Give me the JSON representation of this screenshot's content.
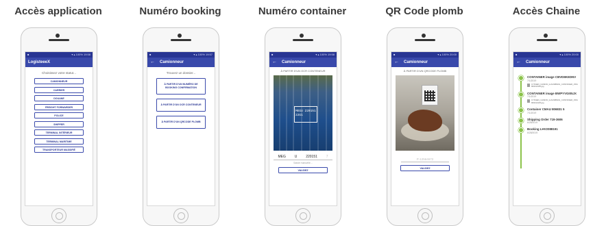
{
  "columns": {
    "acces": {
      "title": "Accès application"
    },
    "booking": {
      "title": "Numéro booking"
    },
    "container": {
      "title": "Numéro container"
    },
    "qr": {
      "title": "QR Code plomb"
    },
    "chaine": {
      "title": "Accès Chaine"
    }
  },
  "screen1": {
    "app_title": "LogisteeeX",
    "prompt": "Choisissez votre statut...",
    "roles": [
      "CAMIONNEUR",
      "CARRIER",
      "DOUANE",
      "FREIGHT FORWARDER",
      "POLICE",
      "SHIPPER",
      "TERMINAL INTÉRIEUR",
      "TERMINAL MARITIME",
      "TRANSPORTEUR MASSIFIÉ"
    ]
  },
  "screen2": {
    "app_title": "Camionneur",
    "prompt": "Trouvez un dossier...",
    "choices": [
      "À PARTIR D'UN NUMÉRO DE BOOKING CONFIRMATION",
      "À PARTIR D'UN OCR CONTENEUR",
      "À PARTIR D'UN QRCODE PLOMB"
    ]
  },
  "screen3": {
    "app_title": "Camionneur",
    "subtitle": "À PARTIR D'UN OCR CONTENEUR",
    "ocr_fields": [
      "MEG",
      "U",
      "220151",
      "7"
    ],
    "hint": "Saisie manuelle...",
    "validate": "VALIDEZ"
  },
  "screen4": {
    "app_title": "Camionneur",
    "subtitle": "À PARTIR D'UN QRCODE PLOMB",
    "field_value": "P-12564672",
    "validate": "VALIDEZ"
  },
  "screen5": {
    "app_title": "Camionneur",
    "events": [
      {
        "title": "CONTAINER image CBVD8KEDNV",
        "date": "7/1/2019",
        "file": "CYPHEN_CAMION_LHV2088191_CONTAINER_1561960414336.jpg"
      },
      {
        "title": "CONTAINER image BWPYVGI05JX",
        "date": "7/1/2019",
        "file": "CYPHEN_CAMION_LHV2088191_CONTAINER_1561960414425.jpg"
      },
      {
        "title": "Container CMAU 806831 5",
        "date": "7/1/2019",
        "file": ""
      },
      {
        "title": "Shipping Order 719-3606",
        "date": "6/28/2019",
        "file": ""
      },
      {
        "title": "Booking LHV2088191",
        "date": "6/28/2019",
        "file": ""
      }
    ]
  },
  "colors": {
    "primary": "#3949ab",
    "status": "#283593",
    "timeline": "#8bc34a"
  },
  "icons": {
    "back": "arrow-left-icon",
    "file": "file-icon"
  }
}
